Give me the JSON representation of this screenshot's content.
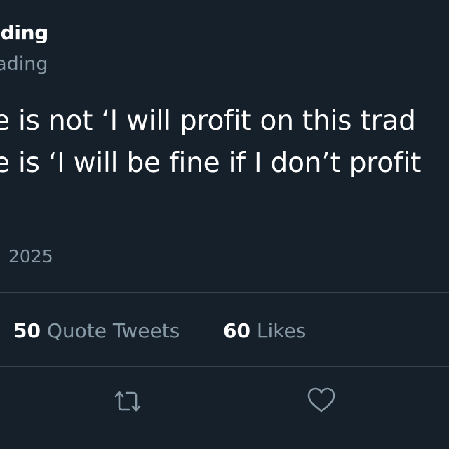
{
  "tweet": {
    "author": {
      "display_name": "ading",
      "handle": "rading"
    },
    "text_lines": [
      "e is not ‘I will profit on this trad",
      "e is ‘I will be fine if I don’t profit"
    ],
    "timestamp": "2025"
  },
  "stats": {
    "quote_tweets": {
      "count": "50",
      "label": "Quote Tweets"
    },
    "likes": {
      "count": "60",
      "label": "Likes"
    }
  },
  "actions": {
    "retweet_icon": "retweet-icon",
    "like_icon": "heart-icon"
  },
  "colors": {
    "background": "#15202b",
    "text_primary": "#ffffff",
    "text_secondary": "#8899a6",
    "divider": "#38444d"
  }
}
